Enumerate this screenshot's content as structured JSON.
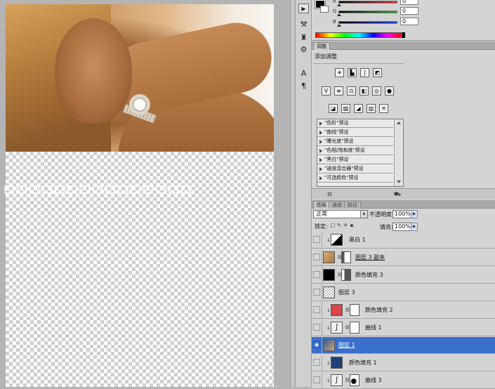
{
  "color_panel": {
    "labels": [
      "R",
      "G",
      "B"
    ],
    "values": [
      "0",
      "0",
      "0"
    ],
    "bar_colors": [
      "#e03030",
      "#20b020",
      "#2040e0"
    ]
  },
  "adjustments": {
    "tabs": [
      "调整"
    ],
    "title": "添加调整",
    "presets": [
      "\"色阶\"预设",
      "\"曲线\"预设",
      "\"曝光度\"预设",
      "\"色相/饱和度\"预设",
      "\"黑白\"预设",
      "\"通道混合器\"预设",
      "\"可选颜色\"预设"
    ]
  },
  "layers_panel": {
    "tabs": [
      "图层",
      "通道",
      "路径"
    ],
    "blend_mode": "正常",
    "opacity_label": "不透明度:",
    "opacity_value": "100%",
    "lock_label": "锁定:",
    "fill_label": "填充:",
    "fill_value": "100%",
    "layers": [
      {
        "name": "黑白 1",
        "thumb": "bw-adjustment",
        "selected": false,
        "mask": false
      },
      {
        "name": "图层 3 副本",
        "thumb": "photo",
        "selected": false,
        "mask": true
      },
      {
        "name": "颜色填充 3",
        "thumb": "#000000",
        "selected": false,
        "mask": true
      },
      {
        "name": "图层 3",
        "thumb": "checker",
        "selected": false,
        "mask": false
      },
      {
        "name": "颜色填充 2",
        "thumb": "#d9454a",
        "selected": false,
        "mask": true
      },
      {
        "name": "曲线 1",
        "thumb": "curves",
        "selected": false,
        "mask": true
      },
      {
        "name": "图层 1",
        "thumb": "photo",
        "selected": true,
        "mask": false
      },
      {
        "name": "颜色填充 1",
        "thumb": "#1f3f7a",
        "selected": false,
        "mask": false
      },
      {
        "name": "曲线 3",
        "thumb": "curves",
        "selected": false,
        "mask": true
      }
    ]
  },
  "colors": {
    "selection": "#3a6fcb",
    "panel_bg": "#d4d4d4"
  }
}
